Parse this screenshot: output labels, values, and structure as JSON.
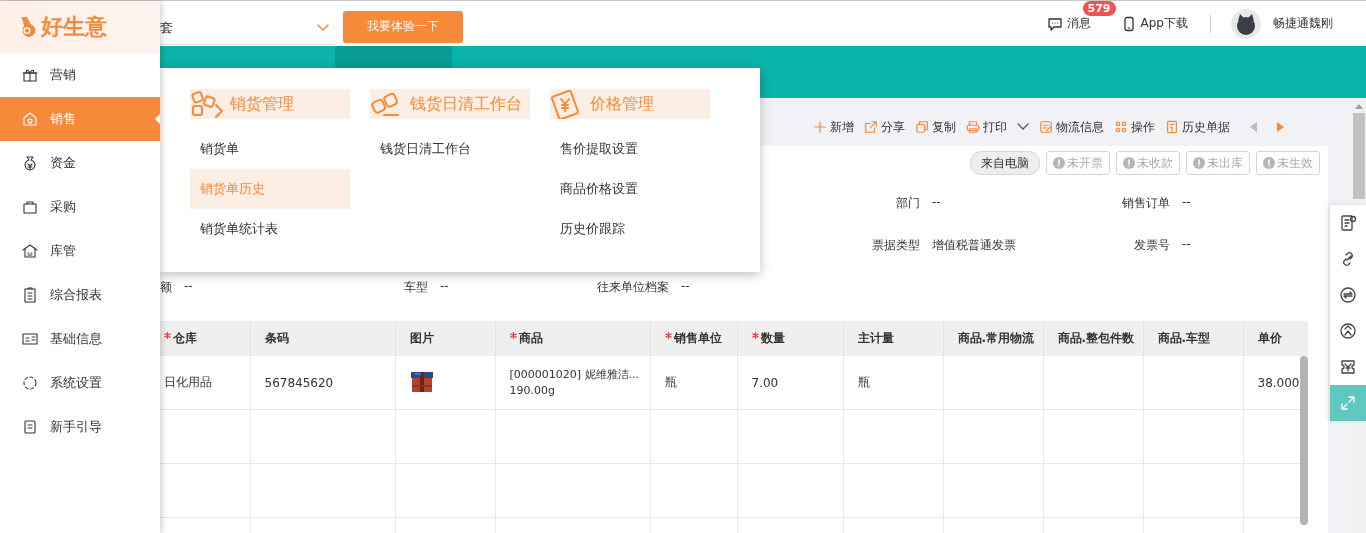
{
  "logo": {
    "text": "好生意"
  },
  "sidebar": {
    "items": [
      {
        "label": "营销",
        "selected": false
      },
      {
        "label": "销售",
        "selected": true
      },
      {
        "label": "资金",
        "selected": false
      },
      {
        "label": "采购",
        "selected": false
      },
      {
        "label": "库管",
        "selected": false
      },
      {
        "label": "综合报表",
        "selected": false
      },
      {
        "label": "基础信息",
        "selected": false
      },
      {
        "label": "系统设置",
        "selected": false
      },
      {
        "label": "新手引导",
        "selected": false
      }
    ]
  },
  "header": {
    "select": {
      "value": "套"
    },
    "trial_button": "我要体验一下",
    "messages": {
      "label": "消息",
      "badge": "579"
    },
    "app_download": "App下载",
    "user": "畅捷通魏刚"
  },
  "toolbar": {
    "items": [
      {
        "label": "新增",
        "has_menu": false
      },
      {
        "label": "分享",
        "has_menu": false
      },
      {
        "label": "复制",
        "has_menu": false
      },
      {
        "label": "打印",
        "has_menu": true
      },
      {
        "label": "物流信息",
        "has_menu": false
      },
      {
        "label": "操作",
        "has_menu": false
      },
      {
        "label": "历史单据",
        "has_menu": false
      }
    ],
    "prev": {
      "disabled": true
    },
    "next": {
      "disabled": false
    }
  },
  "status_chips": [
    {
      "kind": "source",
      "label": "来自电脑"
    },
    {
      "kind": "status",
      "label": "未开票"
    },
    {
      "kind": "status",
      "label": "未收款"
    },
    {
      "kind": "status",
      "label": "未出库"
    },
    {
      "kind": "status",
      "label": "未生效"
    }
  ],
  "form": {
    "rows": [
      [
        {
          "label": "部门",
          "value": "--"
        },
        {
          "label": "销售订单",
          "value": "--"
        }
      ],
      [
        {
          "label": "票据类型",
          "value": "增值税普通发票"
        },
        {
          "label": "发票号",
          "value": "--"
        }
      ],
      [
        {
          "label": "额",
          "value": "--"
        },
        {
          "label": "车型",
          "value": "--"
        },
        {
          "label": "往来单位档案",
          "value": "--"
        }
      ]
    ]
  },
  "table": {
    "columns": [
      {
        "label": "仓库",
        "required": true
      },
      {
        "label": "条码",
        "required": false
      },
      {
        "label": "图片",
        "required": false
      },
      {
        "label": "商品",
        "required": true
      },
      {
        "label": "销售单位",
        "required": true
      },
      {
        "label": "数量",
        "required": true
      },
      {
        "label": "主计量",
        "required": false
      },
      {
        "label": "商品.常用物流",
        "required": false
      },
      {
        "label": "商品.整包件数",
        "required": false
      },
      {
        "label": "商品.车型",
        "required": false
      },
      {
        "label": "单价",
        "required": false
      }
    ],
    "rows": [
      {
        "cells": [
          "日化用品",
          "567845620",
          {
            "kind": "picture"
          },
          "[000001020] 妮维雅洁...\n190.00g",
          "瓶",
          "7.00",
          "瓶",
          null,
          null,
          null,
          "38.000"
        ]
      }
    ]
  },
  "side_tools": [
    {
      "selected": false
    },
    {
      "selected": false
    },
    {
      "selected": false
    },
    {
      "selected": false
    },
    {
      "selected": false
    },
    {
      "selected": true
    }
  ],
  "mega_menu": {
    "groups": [
      {
        "title": "销货管理",
        "items": [
          {
            "label": "销货单",
            "selected": false
          },
          {
            "label": "销货单历史",
            "selected": true
          },
          {
            "label": "销货单统计表",
            "selected": false
          }
        ]
      },
      {
        "title": "钱货日清工作台",
        "items": [
          {
            "label": "钱货日清工作台",
            "selected": false
          }
        ]
      },
      {
        "title": "价格管理",
        "items": [
          {
            "label": "售价提取设置",
            "selected": false
          },
          {
            "label": "商品价格设置",
            "selected": false
          },
          {
            "label": "历史价跟踪",
            "selected": false
          }
        ]
      }
    ]
  }
}
